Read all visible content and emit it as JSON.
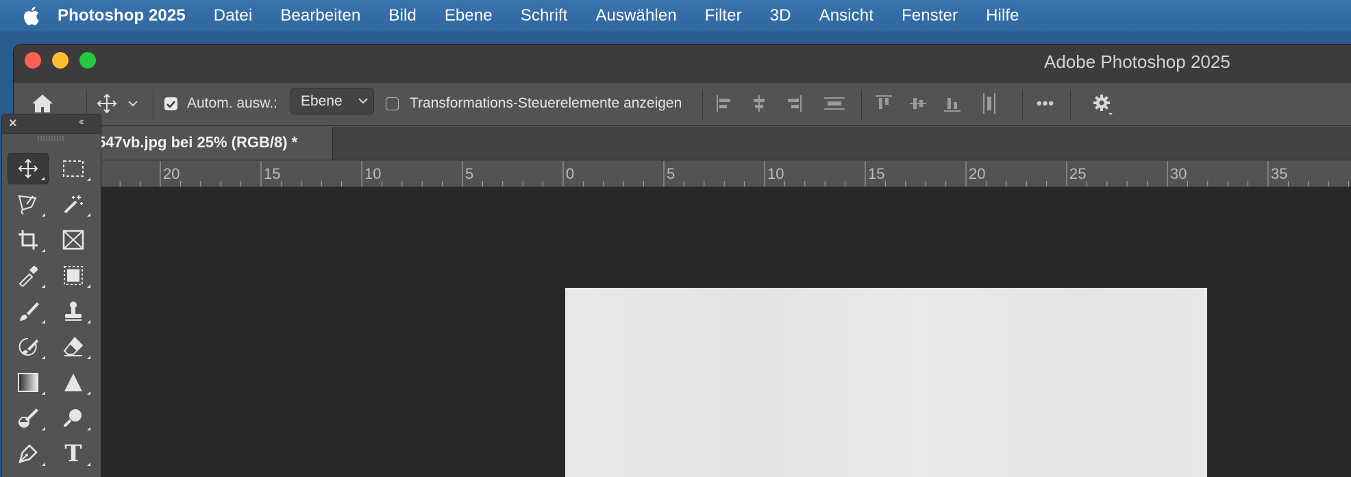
{
  "menubar": {
    "apple_icon": "apple-logo-icon",
    "items": [
      "Photoshop 2025",
      "Datei",
      "Bearbeiten",
      "Bild",
      "Ebene",
      "Schrift",
      "Auswählen",
      "Filter",
      "3D",
      "Ansicht",
      "Fenster",
      "Hilfe"
    ]
  },
  "window": {
    "title": "Adobe Photoshop 2025",
    "traffic_light_colors": {
      "close": "#fe5f57",
      "minimize": "#febc2e",
      "zoom": "#28c840"
    }
  },
  "options_bar": {
    "auto_select_label": "Autom. ausw.:",
    "auto_select_checked": true,
    "auto_select_target": "Ebene",
    "transform_controls_label": "Transformations-Steuerelemente anzeigen",
    "transform_controls_checked": false,
    "more_label": "•••"
  },
  "document_tab": {
    "title": "547vb.jpg bei 25% (RGB/8) *"
  },
  "ruler": {
    "labels": [
      "20",
      "15",
      "10",
      "5",
      "0",
      "5",
      "10",
      "15",
      "20",
      "25",
      "30",
      "35"
    ]
  },
  "tools_panel": {
    "close_label": "×",
    "collapse_label": "‹‹",
    "tools": [
      "move-tool",
      "rectangular-marquee-tool",
      "lasso-tool",
      "magic-wand-tool",
      "crop-tool",
      "frame-tool",
      "eyedropper-tool",
      "object-selection-tool",
      "brush-tool",
      "clone-stamp-tool",
      "history-brush-tool",
      "eraser-tool",
      "gradient-tool",
      "sharpen-tool",
      "dodge-burn-tool",
      "zoom-tool",
      "pen-tool",
      "type-tool"
    ],
    "type_tool_glyph": "T"
  }
}
